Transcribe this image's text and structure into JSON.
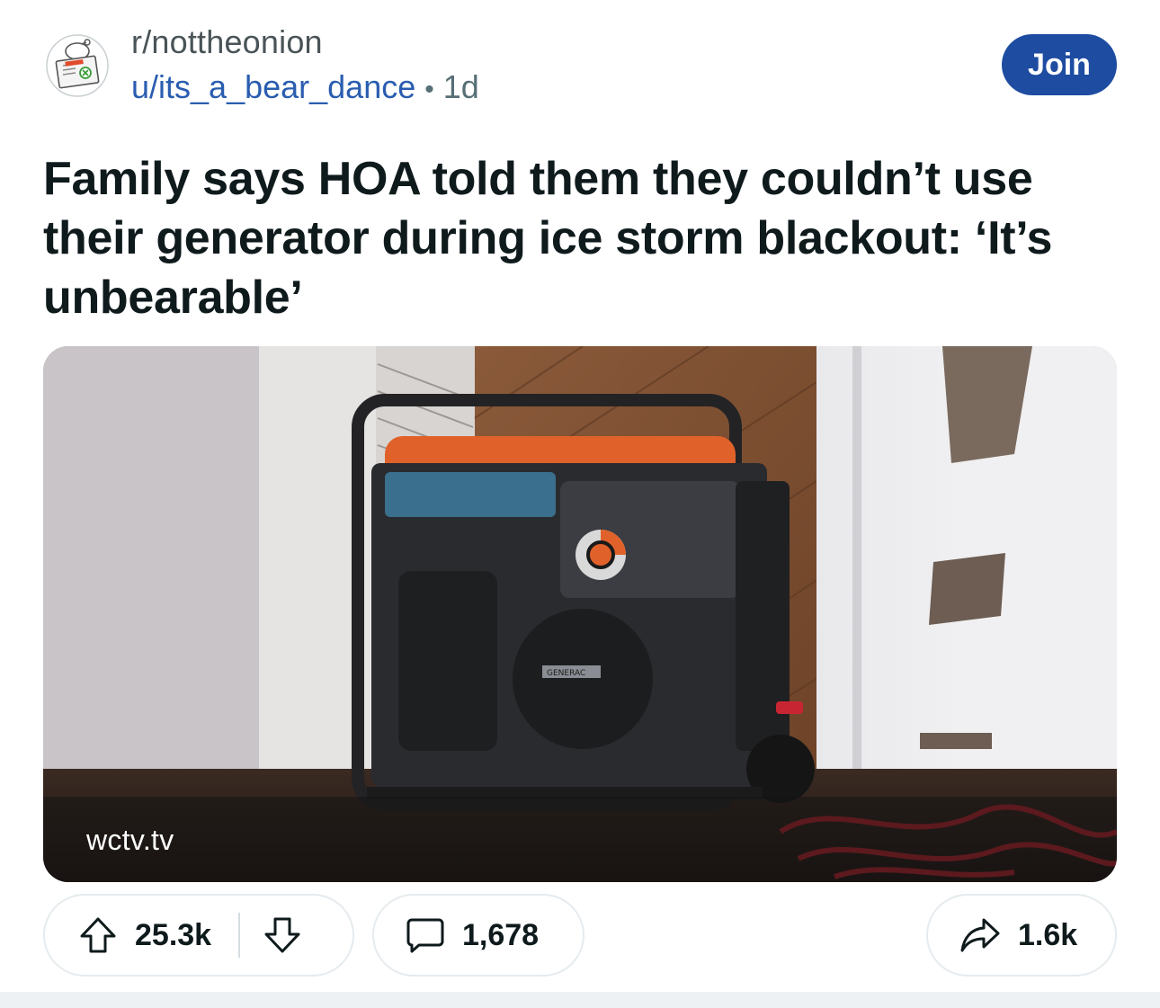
{
  "post": {
    "subreddit": "r/nottheonion",
    "username": "u/its_a_bear_dance",
    "separator": "•",
    "age": "1d",
    "join_label": "Join",
    "title": "Family says HOA told them they couldn’t use their generator during ice storm blackout: ‘It’s unbearable’",
    "link_domain": "wctv.tv",
    "image_brand_text": "GENERAC"
  },
  "actions": {
    "upvotes": "25.3k",
    "comments": "1,678",
    "shares": "1.6k"
  },
  "icons": {
    "avatar": "subreddit-avatar-icon",
    "upvote": "upvote-arrow-icon",
    "downvote": "downvote-arrow-icon",
    "comment": "comment-bubble-icon",
    "share": "share-arrow-icon"
  },
  "colors": {
    "join_button": "#1d4ca1",
    "username": "#2a5db0",
    "subreddit": "#4a5458",
    "generator_accent": "#e0622a"
  }
}
